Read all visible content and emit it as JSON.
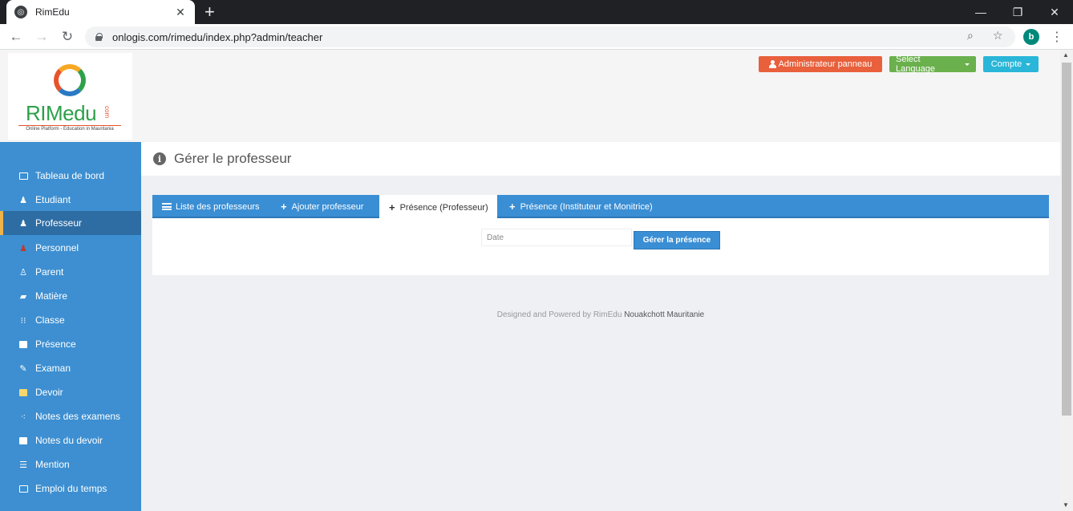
{
  "browser": {
    "tab_title": "RimEdu",
    "tab_close": "✕",
    "new_tab": "+",
    "url": "onlogis.com/rimedu/index.php?admin/teacher",
    "profile_initial": "b",
    "win_minimize": "—",
    "win_restore": "❐",
    "win_close": "✕"
  },
  "header": {
    "logo": {
      "main": "RIMedu",
      "com": "com",
      "sub": "Online Platform - Education in Mauritania"
    },
    "admin_button": "Administrateur panneau",
    "language_button": "Select Language",
    "account_button": "Compte"
  },
  "sidebar": {
    "items": [
      {
        "label": "Tableau de bord",
        "icon": "monitor-icon"
      },
      {
        "label": "Etudiant",
        "icon": "student-icon"
      },
      {
        "label": "Professeur",
        "icon": "teacher-icon",
        "active": true
      },
      {
        "label": "Personnel",
        "icon": "staff-icon"
      },
      {
        "label": "Parent",
        "icon": "parent-icon"
      },
      {
        "label": "Matière",
        "icon": "subject-icon"
      },
      {
        "label": "Classe",
        "icon": "class-icon"
      },
      {
        "label": "Présence",
        "icon": "attendance-icon"
      },
      {
        "label": "Examan",
        "icon": "pencil-icon"
      },
      {
        "label": "Devoir",
        "icon": "homework-icon"
      },
      {
        "label": "Notes des examens",
        "icon": "network-icon"
      },
      {
        "label": "Notes du devoir",
        "icon": "notes-icon"
      },
      {
        "label": "Mention",
        "icon": "list-icon"
      },
      {
        "label": "Emploi du temps",
        "icon": "calendar-icon"
      }
    ]
  },
  "main": {
    "page_title": "Gérer le professeur",
    "tabs": [
      {
        "label": "Liste des professeurs",
        "icon": "list-icon"
      },
      {
        "label": "Ajouter professeur",
        "icon": "plus-icon"
      },
      {
        "label": "Présence (Professeur)",
        "icon": "plus-icon",
        "active": true
      },
      {
        "label": "Présence (Instituteur et Monitrice)",
        "icon": "plus-icon"
      }
    ],
    "date_placeholder": "Date",
    "manage_button": "Gérer la présence"
  },
  "footer": {
    "text": "Designed and Powered by RimEdu",
    "location": "Nouakchott Mauritanie"
  },
  "colors": {
    "sidebar": "#3d8fd1",
    "sidebar_active": "#2e6da4",
    "accent": "#f0b34a",
    "admin_button": "#e8603c",
    "language_button": "#6ab04c",
    "account_button": "#29b6d8"
  }
}
